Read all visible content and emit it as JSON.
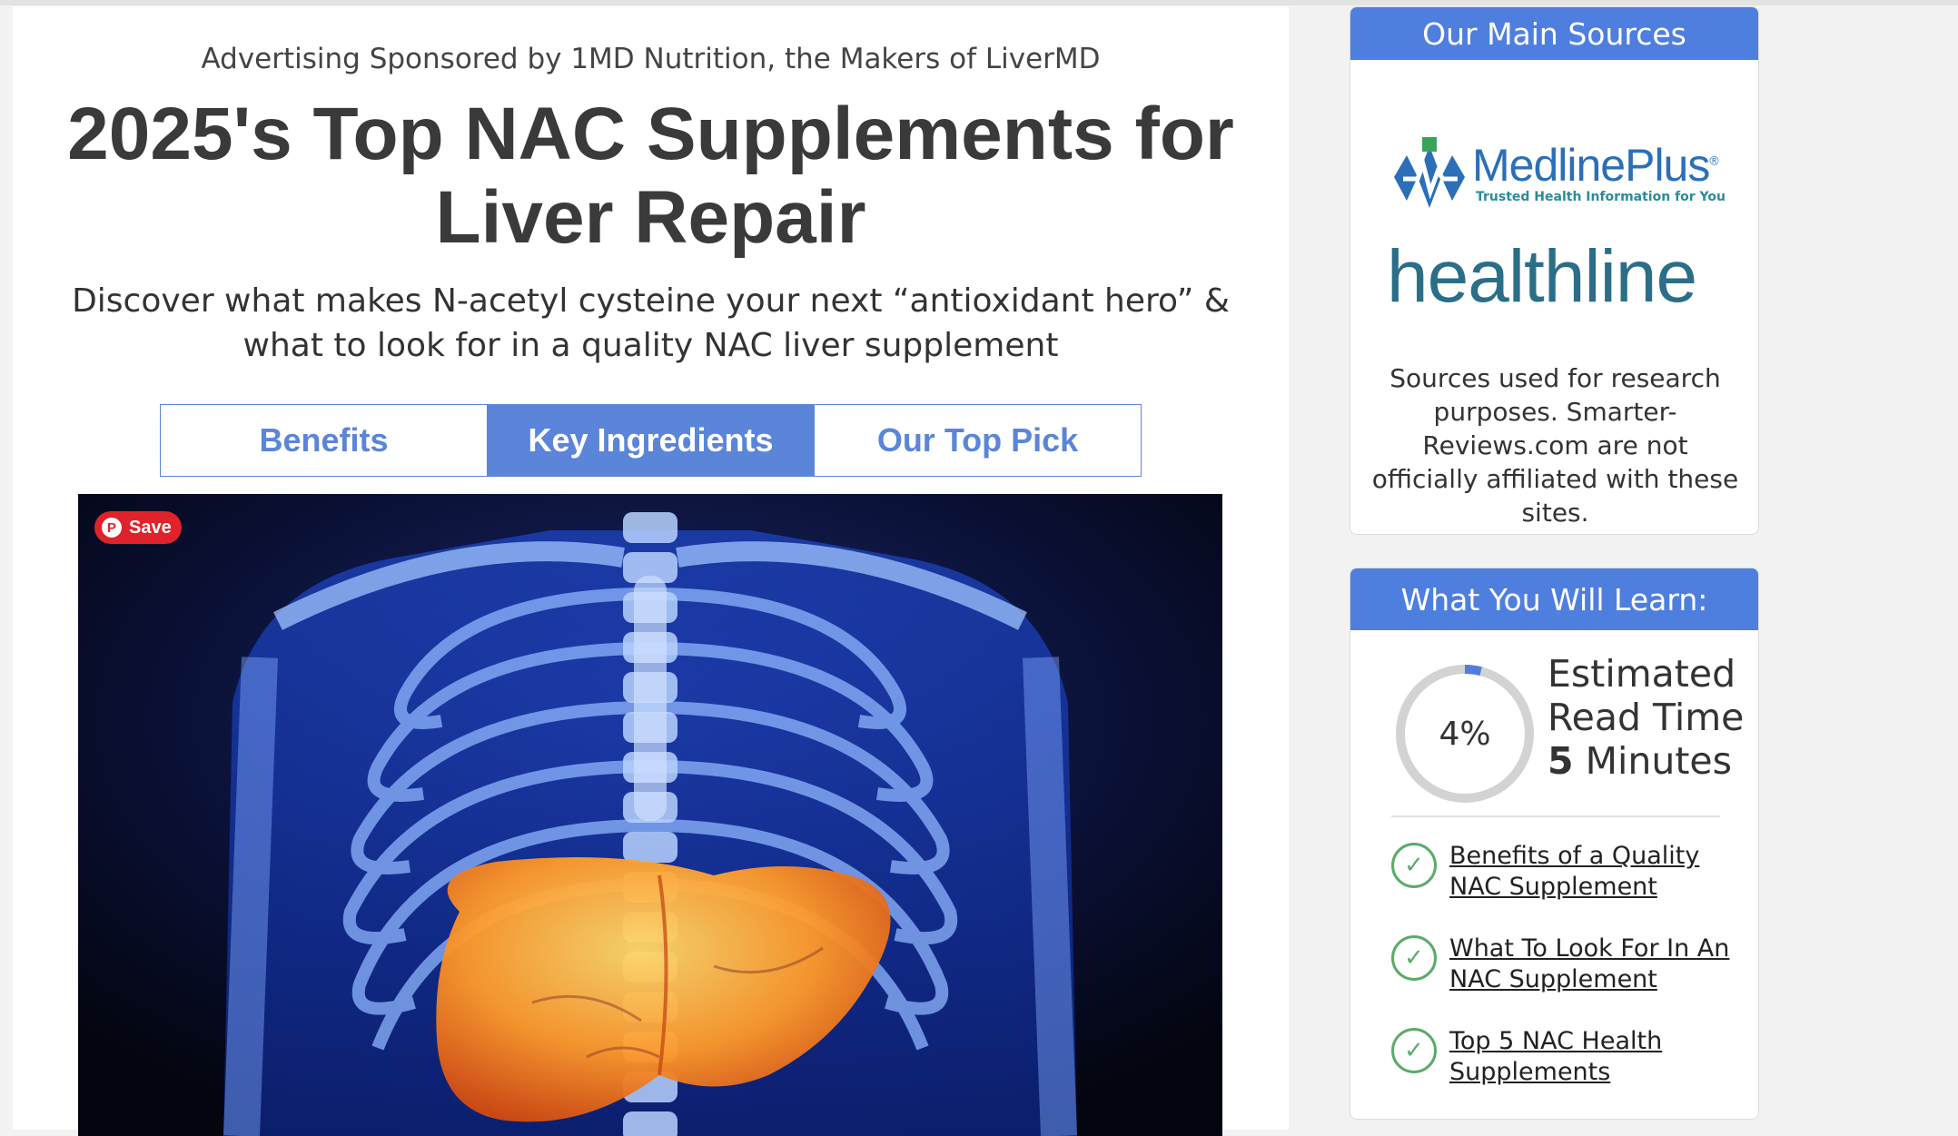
{
  "sponsor": "Advertising Sponsored by 1MD Nutrition, the Makers of LiverMD",
  "headline": "2025's Top NAC Supplements for Liver Repair",
  "subhead": "Discover what makes N-acetyl cysteine your next “antioxidant hero” & what to look for in a quality NAC liver supplement",
  "tabs": [
    {
      "label": "Benefits",
      "active": false
    },
    {
      "label": "Key Ingredients",
      "active": true
    },
    {
      "label": "Our Top Pick",
      "active": false
    }
  ],
  "hero": {
    "save_label": "Save",
    "pin_glyph": "P"
  },
  "sidebar": {
    "sources": {
      "title": "Our Main Sources",
      "medline_name": "MedlinePlus",
      "medline_reg": "®",
      "medline_tagline": "Trusted Health Information for You",
      "healthline_name": "healthline",
      "note": "Sources used for research purposes. Smarter-Reviews.com are not officially affiliated with these sites."
    },
    "learn": {
      "title": "What You Will Learn:",
      "progress_percent": 4,
      "progress_label": "4%",
      "readtime_line1": "Estimated",
      "readtime_line2": "Read Time",
      "readtime_minutes": "5",
      "readtime_unit": "Minutes",
      "items": [
        {
          "label": "Benefits of a Quality NAC Supplement"
        },
        {
          "label": "What To Look For In An NAC Supplement"
        },
        {
          "label": "Top 5 NAC Health Supplements"
        }
      ]
    }
  },
  "colors": {
    "accent": "#5b85d9",
    "card_header": "#4f7fde",
    "check": "#5aab6a",
    "pinterest": "#e0232b"
  }
}
